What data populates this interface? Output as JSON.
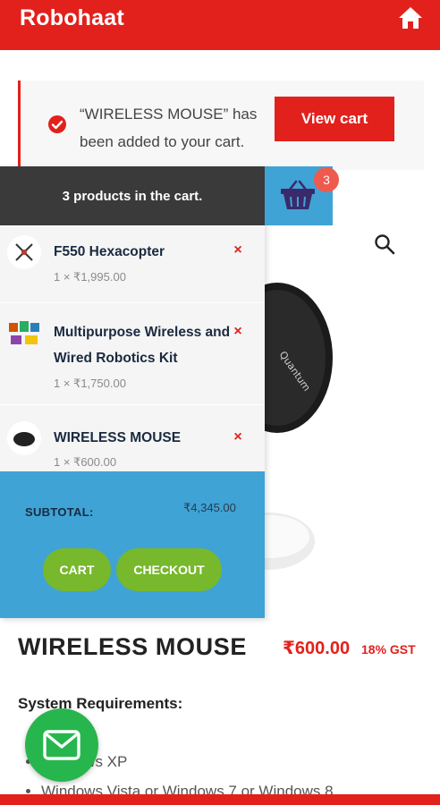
{
  "header": {
    "brand": "Robohaat",
    "home_icon": "home-icon"
  },
  "notice": {
    "message": "“WIRELESS MOUSE” has been added to your cart.",
    "button": "View cart",
    "icon": "check-circle-icon"
  },
  "cart_toggle": {
    "count": "3",
    "icon": "basket-icon"
  },
  "search": {
    "icon": "search-icon"
  },
  "mini_cart": {
    "heading": "3 products in the cart.",
    "items": [
      {
        "name": "F550 Hexacopter",
        "meta": "1 × ₹1,995.00",
        "remove": "×"
      },
      {
        "name": "Multipurpose Wireless and Wired Robotics Kit",
        "meta": "1 × ₹1,750.00",
        "remove": "×"
      },
      {
        "name": "WIRELESS MOUSE",
        "meta": "1 × ₹600.00",
        "remove": "×"
      }
    ],
    "subtotal_label": "SUBTOTAL:",
    "subtotal_value": "₹4,345.00",
    "cart_button": "CART",
    "checkout_button": "CHECKOUT"
  },
  "product": {
    "title": "WIRELESS MOUSE",
    "price": "₹600.00",
    "tax": "18% GST",
    "requirements_heading": "System Requirements:",
    "requirements": [
      "Windows XP",
      "Windows Vista or Windows 7 or Windows 8"
    ]
  },
  "fab": {
    "icon": "email-icon"
  },
  "colors": {
    "brand_red": "#e2211c",
    "accent_blue": "#3fa3d6",
    "pill_green": "#77b82c",
    "fab_green": "#27b64d"
  }
}
